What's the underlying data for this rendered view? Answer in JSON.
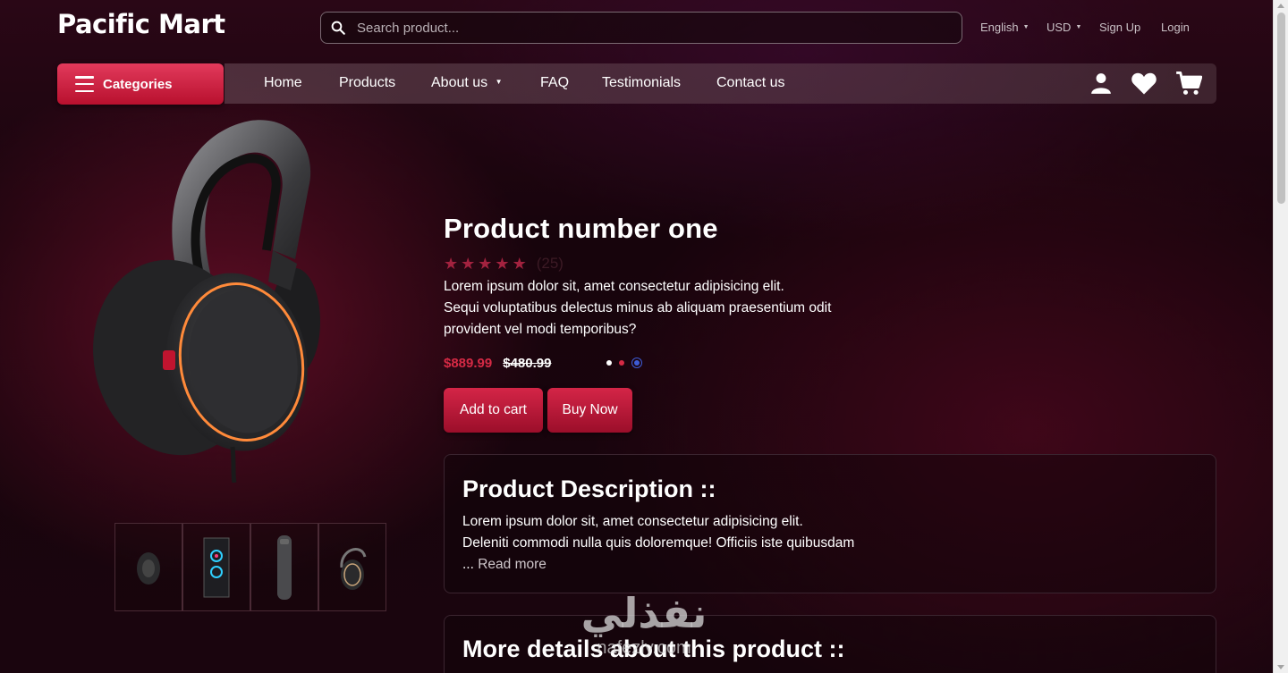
{
  "brand": {
    "name": "Pacific Mart"
  },
  "search": {
    "placeholder": "Search product..."
  },
  "top_links": {
    "language": "English",
    "currency": "USD",
    "sign_up": "Sign Up",
    "login": "Login"
  },
  "categories_button": {
    "label": "Categories"
  },
  "nav": {
    "home": "Home",
    "products": "Products",
    "about": "About us",
    "faq": "FAQ",
    "testimonials": "Testimonials",
    "contact": "Contact us"
  },
  "nav_icons": [
    "user-icon",
    "heart-icon",
    "cart-icon"
  ],
  "product": {
    "title": "Product number one",
    "rating": 5,
    "review_count": "(25)",
    "description_lines": [
      "Lorem ipsum dolor sit, amet consectetur adipisicing elit.",
      "Sequi voluptatibus delectus minus ab aliquam praesentium odit",
      "provident vel modi temporibus?"
    ],
    "price_current": "$889.99",
    "price_old": "$480.99",
    "color_options": [
      "#ffffff",
      "#d62a45",
      "#3d5bd6"
    ],
    "selected_color": "#3d5bd6",
    "add_to_cart": "Add to cart",
    "buy_now": "Buy Now"
  },
  "thumbnails": [
    "headphones-thumb",
    "pc-case-thumb",
    "speaker-thumb",
    "headset-thumb"
  ],
  "description_card": {
    "heading": "Product Description ::",
    "lines": [
      "Lorem ipsum dolor sit, amet consectetur adipisicing elit.",
      "Deleniti commodi nulla quis doloremque! Officiis iste quibusdam"
    ],
    "ellipsis": "...",
    "read_more": "Read more"
  },
  "details_card": {
    "heading": "More details about this product ::"
  },
  "watermark": {
    "arabic": "نفذلي",
    "latin": "nafezly.com"
  },
  "colors": {
    "accent": "#d62a45",
    "button_top": "#d42547",
    "button_bottom": "#9b0e2a"
  }
}
